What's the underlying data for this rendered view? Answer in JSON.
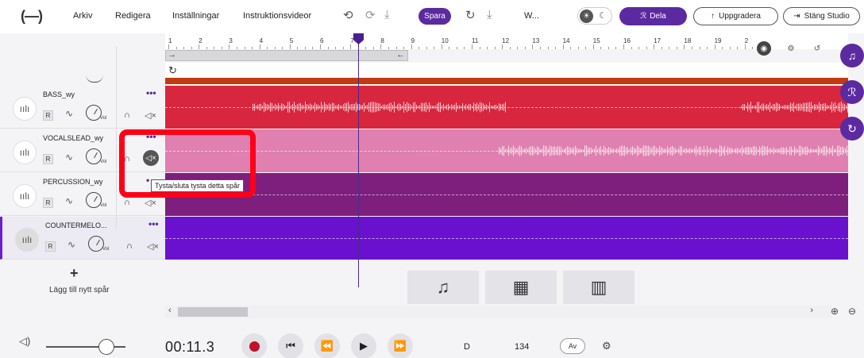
{
  "topbar": {
    "logo": "(—)",
    "menu": [
      "Arkiv",
      "Redigera",
      "Inställningar",
      "Instruktionsvideor"
    ],
    "undo_icon": "⟲",
    "redo_icon": "⟳",
    "download_icon": "⤓",
    "save_label": "Spara",
    "refresh_icon": "↻",
    "download2_icon": "⤓",
    "project_title": "W...",
    "sun_icon": "☀",
    "moon_icon": "☾",
    "share_icon": "ℛ",
    "share_label": "Dela",
    "upgrade_icon": "↑",
    "upgrade_label": "Uppgradera",
    "close_studio_icon": "⇥",
    "close_studio_label": "Stäng Studio"
  },
  "ruler": {
    "numbers": [
      "1",
      "2",
      "3",
      "4",
      "5",
      "6",
      "7",
      "8",
      "9",
      "10",
      "11",
      "12",
      "13",
      "14",
      "15",
      "16",
      "17",
      "18",
      "19",
      "2"
    ],
    "loop_left": "→",
    "loop_right": "←",
    "loop_icon": "↻",
    "right_icons": [
      "◉",
      "⚙",
      "↺"
    ]
  },
  "tracks": [
    {
      "name": "BASS_wy",
      "color": "#d7263d",
      "r_label": "R",
      "fx_icon": "∿",
      "vol_label": "Vol",
      "headphones_icon": "∩",
      "mute_icon": "◁×",
      "more_icon": "•••",
      "avatar_icon": "ıılı"
    },
    {
      "name": "VOCALSLEAD_wy",
      "color": "#e080b0",
      "r_label": "R",
      "fx_icon": "∿",
      "vol_label": "Vol",
      "headphones_icon": "∩",
      "mute_icon": "◁×",
      "more_icon": "•••",
      "avatar_icon": "ıılı"
    },
    {
      "name": "PERCUSSION_wy",
      "color": "#7e1f7e",
      "r_label": "R",
      "fx_icon": "∿",
      "vol_label": "Vol",
      "headphones_icon": "∩",
      "mute_icon": "◁×",
      "more_icon": "•",
      "avatar_icon": "ıılı"
    },
    {
      "name": "COUNTERMELO...",
      "color": "#6a10cf",
      "r_label": "R",
      "fx_icon": "∿",
      "vol_label": "Vol",
      "headphones_icon": "∩",
      "mute_icon": "◁×",
      "more_icon": "•••",
      "avatar_icon": "ıılı"
    }
  ],
  "add_track": {
    "plus": "+",
    "label": "Lägg till nytt spår"
  },
  "tooltip": "Tysta/sluta tysta detta spår",
  "pads": [
    "♫",
    "▦",
    "▥"
  ],
  "scroll": {
    "left": "‹",
    "right": "›",
    "zoom_in": "⊕",
    "zoom_out": "⊖"
  },
  "fabs": [
    "♫",
    "ℛ",
    "↻"
  ],
  "transport": {
    "volume_icon": "◁)",
    "time": "00:11.3",
    "prev_icon": "⏮",
    "rewind_icon": "⏪",
    "play_icon": "▶",
    "forward_icon": "⏩",
    "key": "D",
    "bpm": "134",
    "av_label": "Av",
    "settings_icon": "⚙"
  }
}
